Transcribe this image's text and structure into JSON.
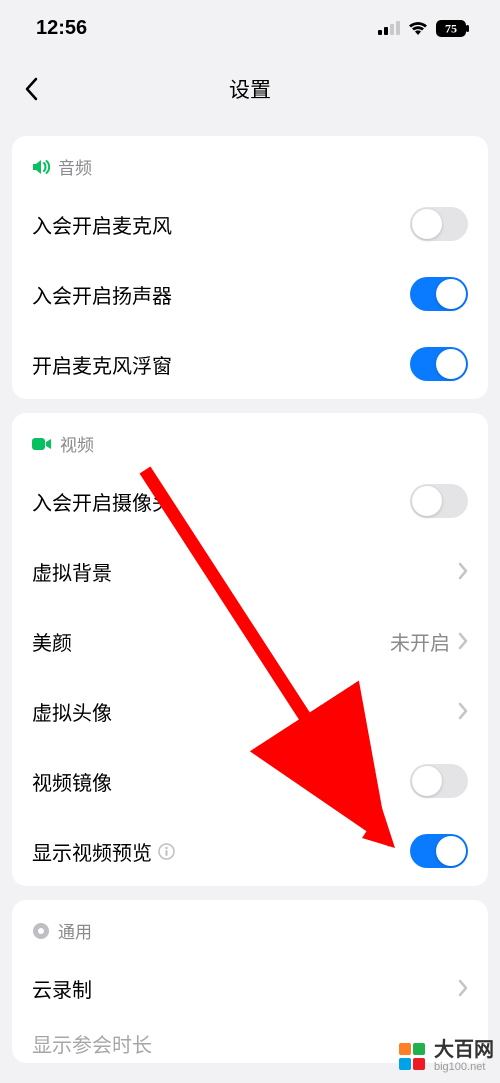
{
  "status": {
    "time": "12:56",
    "battery": "75"
  },
  "nav": {
    "title": "设置"
  },
  "groups": {
    "audio": {
      "title": "音频",
      "mic_on_join": "入会开启麦克风",
      "speaker_on_join": "入会开启扬声器",
      "mic_float": "开启麦克风浮窗"
    },
    "video": {
      "title": "视频",
      "camera_on_join": "入会开启摄像头",
      "virtual_bg": "虚拟背景",
      "beauty": "美颜",
      "beauty_value": "未开启",
      "virtual_avatar": "虚拟头像",
      "mirror": "视频镜像",
      "show_preview": "显示视频预览"
    },
    "general": {
      "title": "通用",
      "cloud_record": "云录制",
      "cutoff": "显示参会时长"
    }
  },
  "watermark": {
    "name": "大百网",
    "url": "big100.net"
  },
  "colors": {
    "accent": "#07C160"
  }
}
